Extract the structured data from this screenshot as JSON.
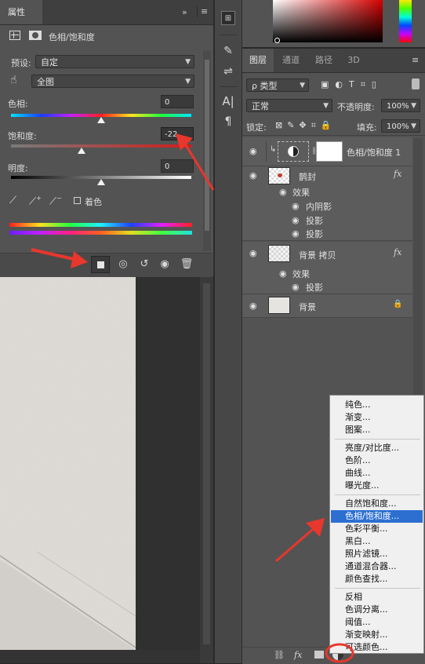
{
  "properties": {
    "tab_label": "属性",
    "collapse_glyph": "»",
    "menu_glyph": "≡",
    "header_title": "色相/饱和度",
    "preset_label": "预设:",
    "preset_value": "自定",
    "channel_value": "全图",
    "hue_label": "色相:",
    "hue_value": "0",
    "hue_level_pct": 50,
    "saturation_label": "饱和度:",
    "saturation_value": "-22",
    "saturation_level_pct": 39,
    "lightness_label": "明度:",
    "lightness_value": "0",
    "lightness_level_pct": 50,
    "colorize_label": "着色"
  },
  "layers_panel": {
    "tabs": [
      "图层",
      "通道",
      "路径",
      "3D"
    ],
    "active_tab_index": 0,
    "filter_kind": "ρ 类型",
    "blend_mode": "正常",
    "opacity_label": "不透明度:",
    "opacity_value": "100%",
    "lock_label": "锁定:",
    "fill_label": "填充:",
    "fill_value": "100%",
    "layers": [
      {
        "name": "色相/饱和度 1"
      },
      {
        "name": "鹊封"
      },
      {
        "name": "背景 拷贝"
      },
      {
        "name": "背景"
      }
    ],
    "effects_label": "效果",
    "inner_shadow": "内阴影",
    "drop_shadow": "投影",
    "fx_label": "fx"
  },
  "adjustment_menu": {
    "items": [
      [
        "纯色...",
        "渐变...",
        "图案..."
      ],
      [
        "亮度/对比度...",
        "色阶...",
        "曲线...",
        "曝光度..."
      ],
      [
        "自然饱和度...",
        "色相/饱和度...",
        "色彩平衡...",
        "黑白...",
        "照片滤镜...",
        "通道混合器...",
        "颜色查找..."
      ],
      [
        "反相",
        "色调分离...",
        "阈值...",
        "渐变映射...",
        "可选颜色..."
      ]
    ],
    "selected_label": "色相/饱和度..."
  },
  "colors": {
    "panel_bg": "#535353",
    "dark_bg": "#282828",
    "arrow_red": "#e8372d",
    "menu_highlight": "#2c6fd1"
  }
}
